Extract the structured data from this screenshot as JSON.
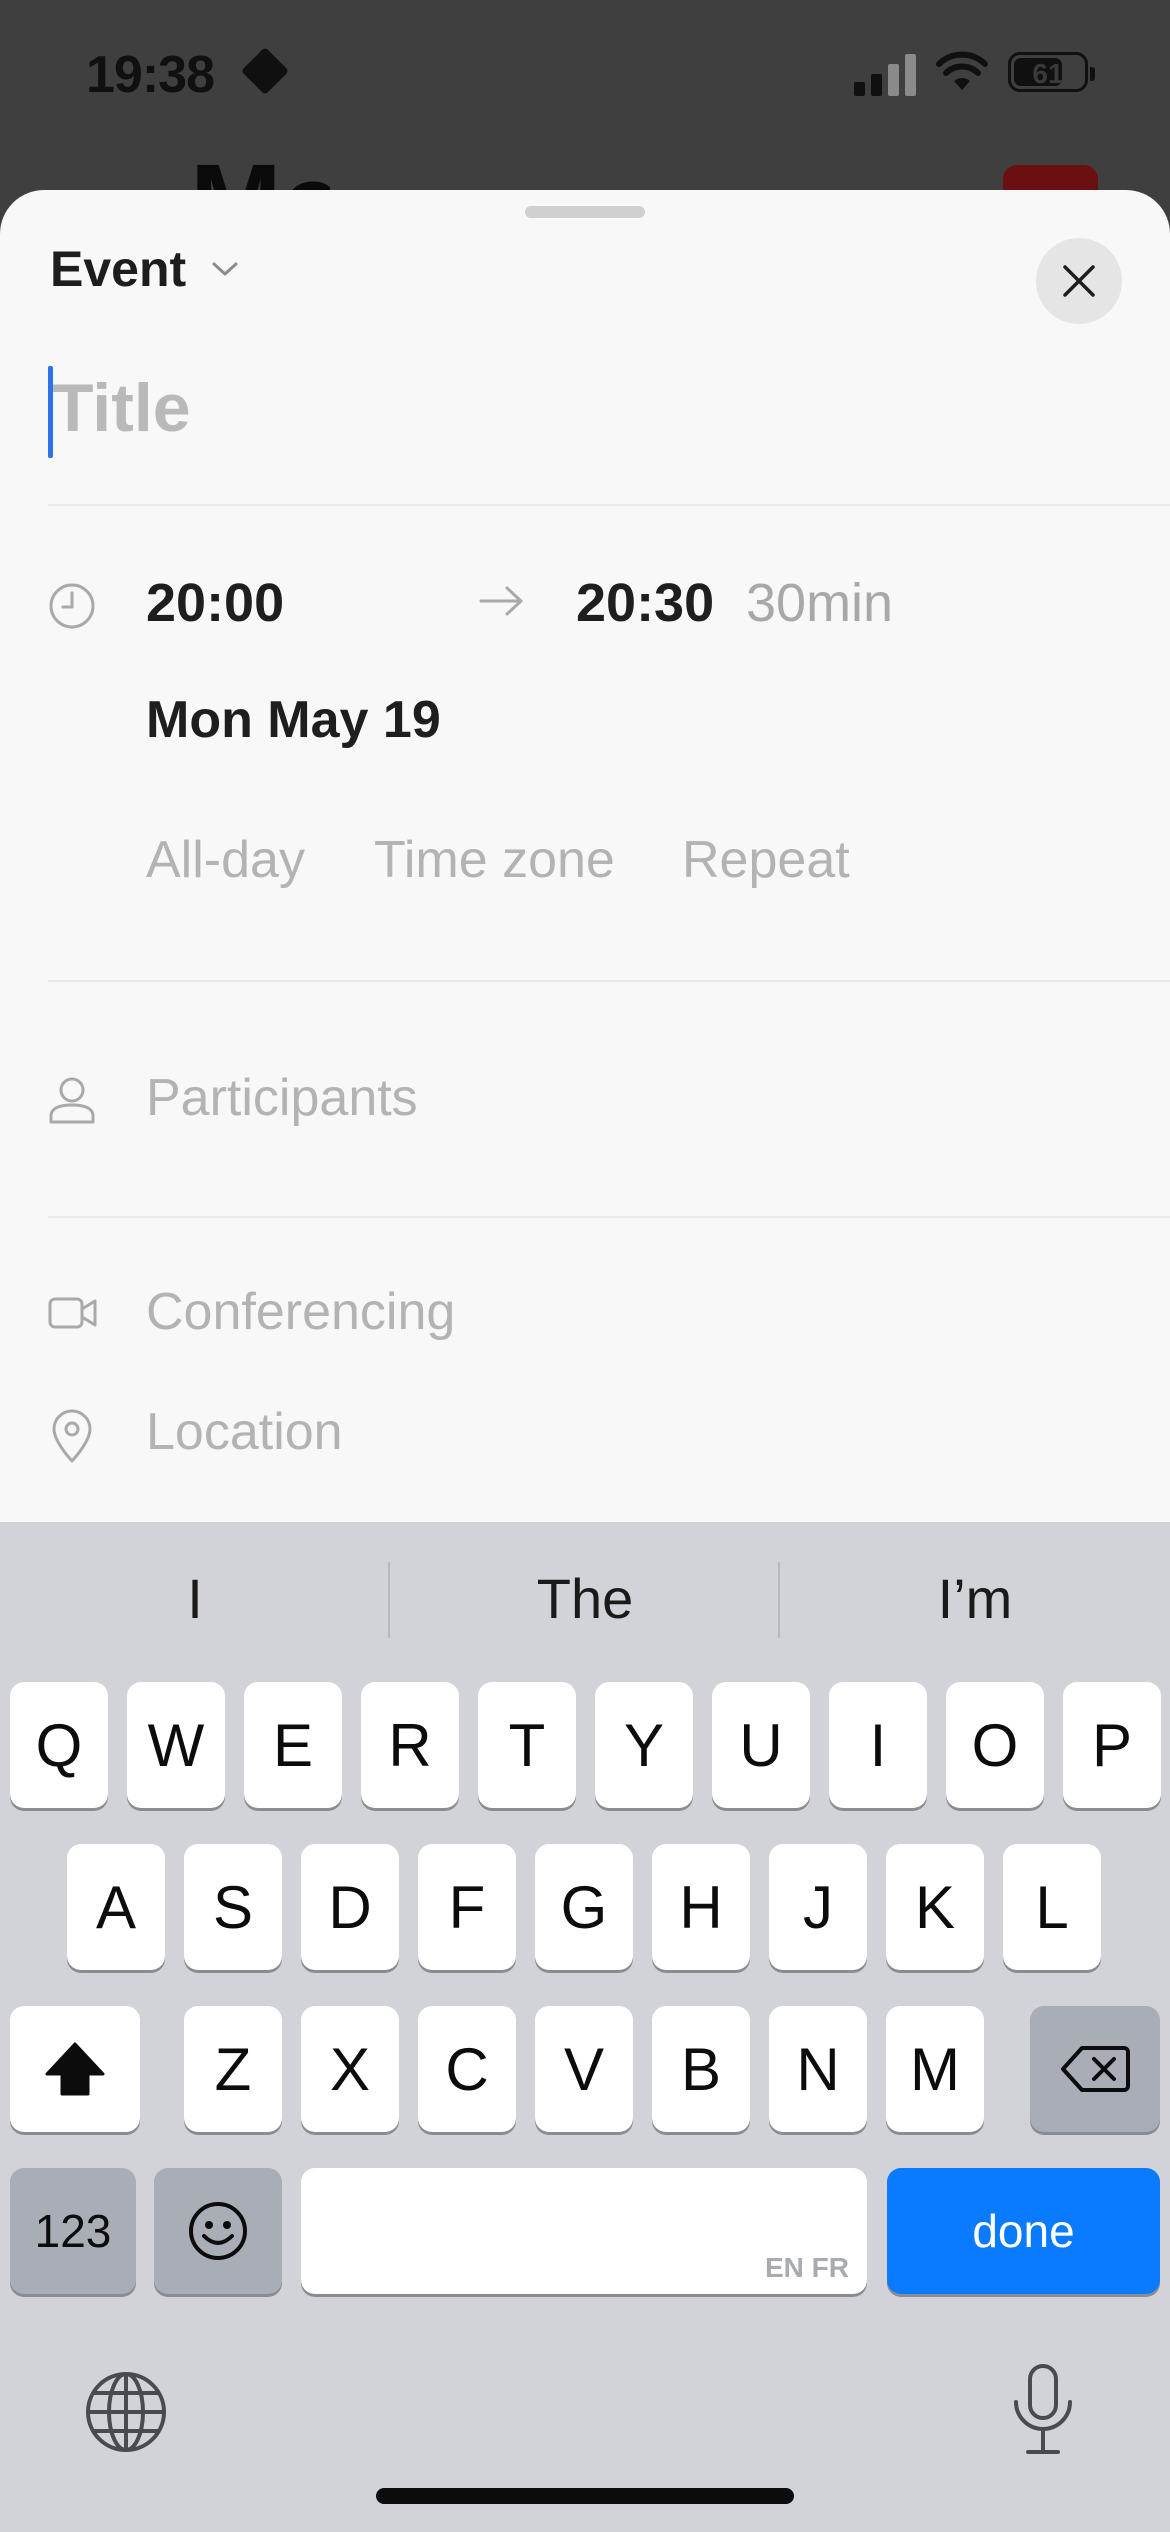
{
  "status_bar": {
    "time": "19:38",
    "battery": "61"
  },
  "sheet": {
    "type_label": "Event",
    "title_placeholder": "Title",
    "time_start": "20:00",
    "time_end": "20:30",
    "duration": "30min",
    "date": "Mon May 19",
    "options": [
      "All-day",
      "Time zone",
      "Repeat"
    ],
    "participants": "Participants",
    "conferencing": "Conferencing",
    "location": "Location"
  },
  "keyboard": {
    "suggestions": [
      "I",
      "The",
      "I’m"
    ],
    "row1": [
      "Q",
      "W",
      "E",
      "R",
      "T",
      "Y",
      "U",
      "I",
      "O",
      "P"
    ],
    "row2": [
      "A",
      "S",
      "D",
      "F",
      "G",
      "H",
      "J",
      "K",
      "L"
    ],
    "row3": [
      "Z",
      "X",
      "C",
      "V",
      "B",
      "N",
      "M"
    ],
    "numbers_key": "123",
    "space_languages": "EN FR",
    "done_key": "done"
  },
  "colors": {
    "accent": "#0a7bff",
    "caret": "#2d72e8"
  }
}
